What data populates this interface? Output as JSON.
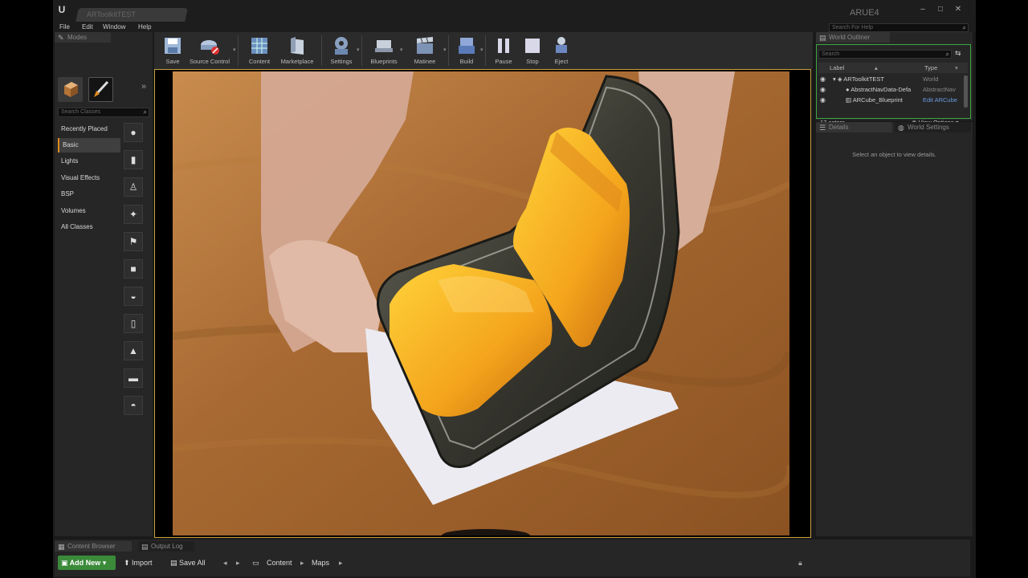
{
  "window": {
    "logo": "U",
    "doc_tab": "ARToolkitTEST",
    "project_name": "ARUE4",
    "controls": [
      "–",
      "□",
      "✕"
    ],
    "help_search_placeholder": "Search For Help"
  },
  "menu": [
    "File",
    "Edit",
    "Window",
    "Help"
  ],
  "modes": {
    "tab_label": "Modes",
    "search_placeholder": "Search Classes",
    "categories": [
      "Recently Placed",
      "Basic",
      "Lights",
      "Visual Effects",
      "BSP",
      "Volumes",
      "All Classes"
    ],
    "active_category": "Basic",
    "item_icons": [
      "sphere-icon",
      "cylinder-icon",
      "pawn-icon",
      "point-light-icon",
      "player-start-icon",
      "cube-icon",
      "sphere-icon",
      "cylinder-icon",
      "cone-icon",
      "plane-icon",
      "sphere-icon"
    ]
  },
  "toolbar": {
    "buttons": [
      {
        "label": "Save",
        "icon": "save-icon"
      },
      {
        "label": "Source Control",
        "icon": "source-control-icon"
      },
      {
        "label": "Content",
        "icon": "content-icon"
      },
      {
        "label": "Marketplace",
        "icon": "marketplace-icon"
      },
      {
        "label": "Settings",
        "icon": "settings-icon"
      },
      {
        "label": "Blueprints",
        "icon": "blueprints-icon"
      },
      {
        "label": "Matinee",
        "icon": "matinee-icon"
      },
      {
        "label": "Build",
        "icon": "build-icon"
      },
      {
        "label": "Pause",
        "icon": "pause-icon"
      },
      {
        "label": "Stop",
        "icon": "stop-icon"
      },
      {
        "label": "Eject",
        "icon": "eject-icon"
      }
    ]
  },
  "outliner": {
    "tab_label": "World Outliner",
    "search_placeholder": "Search",
    "col_label": "Label",
    "col_type": "Type",
    "rows": [
      {
        "label": "ARToolkitTEST",
        "type": "World",
        "type_link": false
      },
      {
        "label": "AbstractNavData-Defa",
        "type": "AbstractNav",
        "type_link": false
      },
      {
        "label": "ARCube_Blueprint",
        "type": "Edit ARCube",
        "type_link": true
      }
    ],
    "count": "17 actors",
    "view_options": "View Options"
  },
  "details": {
    "tab_label": "Details",
    "tab2_label": "World Settings",
    "empty_message": "Select an object to view details."
  },
  "bottom": {
    "tab1": "Content Browser",
    "tab2": "Output Log",
    "add_new": "Add New",
    "import": "Import",
    "save_all": "Save All",
    "crumbs": [
      "Content",
      "Maps"
    ]
  },
  "colors": {
    "accent_orange": "#e08a1e",
    "outliner_border": "#3da843",
    "add_new_green": "#3a8a3a",
    "viewport_border": "#c9a13c"
  }
}
